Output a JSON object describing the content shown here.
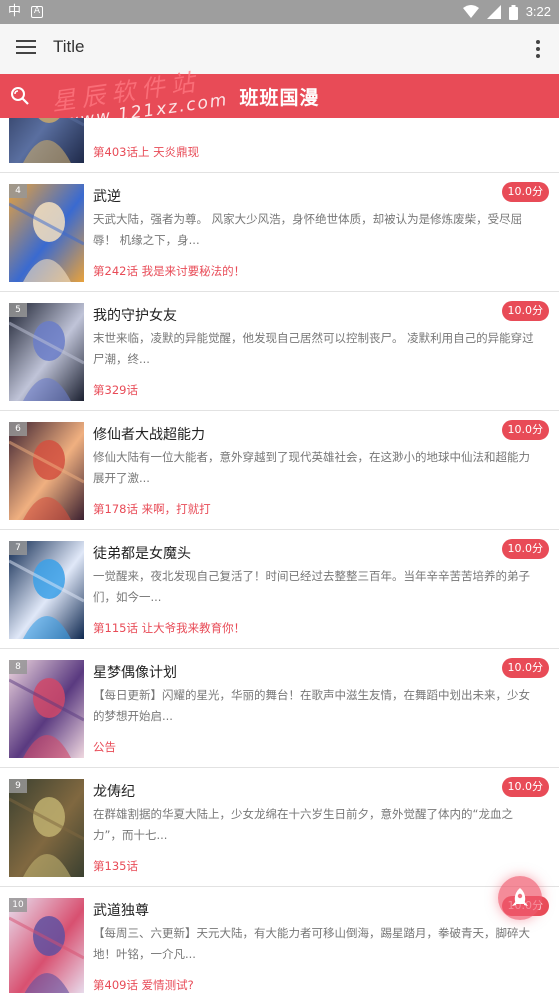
{
  "status_bar": {
    "time": "3:22"
  },
  "app_bar": {
    "title": "Title"
  },
  "header": {
    "brand": "班班国漫"
  },
  "watermark": {
    "cn": "星辰软件站",
    "url": "www.121xz.com"
  },
  "list": [
    {
      "rank": "",
      "title": "",
      "desc": "",
      "chapter": "第403话上 天炎鼎现",
      "score": "",
      "cover_colors": [
        "#1f2a4a",
        "#c8a86a",
        "#5a6fa0"
      ]
    },
    {
      "rank": "4",
      "title": "武逆",
      "desc": "天武大陆，强者为尊。 风家大少风浩，身怀绝世体质，却被认为是修炼废柴，受尽屈辱！ 机缘之下，身...",
      "chapter": "第242话 我是来讨要秘法的！",
      "score": "10.0分",
      "cover_colors": [
        "#e9a23b",
        "#f4e0c0",
        "#3a6ad0"
      ]
    },
    {
      "rank": "5",
      "title": "我的守护女友",
      "desc": "末世来临，凌默的异能觉醒，他发现自己居然可以控制丧尸。 凌默利用自己的异能穿过尸潮，终...",
      "chapter": "第329话",
      "score": "10.0分",
      "cover_colors": [
        "#1b2030",
        "#6a7cc8",
        "#c0c4d8"
      ]
    },
    {
      "rank": "6",
      "title": "修仙者大战超能力",
      "desc": "修仙大陆有一位大能者，意外穿越到了现代英雄社会，在这渺小的地球中仙法和超能力展开了激...",
      "chapter": "第178话 来啊，打就打",
      "score": "10.0分",
      "cover_colors": [
        "#3a2030",
        "#d25040",
        "#f0b080"
      ]
    },
    {
      "rank": "7",
      "title": "徒弟都是女魔头",
      "desc": "一觉醒来，夜北发现自己复活了！时间已经过去整整三百年。当年辛辛苦苦培养的弟子们，如今一...",
      "chapter": "第115话 让大爷我来教育你！",
      "score": "10.0分",
      "cover_colors": [
        "#0e2850",
        "#3aa0e8",
        "#e0e8f8"
      ]
    },
    {
      "rank": "8",
      "title": "星梦偶像计划",
      "desc": "【每日更新】闪耀的星光，华丽的舞台！在歌声中滋生友情，在舞蹈中划出未来，少女的梦想开始启...",
      "chapter": "公告",
      "score": "10.0分",
      "cover_colors": [
        "#f0d8e0",
        "#d04868",
        "#5a3a80"
      ]
    },
    {
      "rank": "9",
      "title": "龙俦纪",
      "desc": "在群雄割据的华夏大陆上，少女龙绵在十六岁生日前夕，意外觉醒了体内的“龙血之力”，而十七...",
      "chapter": "第135话",
      "score": "10.0分",
      "cover_colors": [
        "#3a4030",
        "#c0b070",
        "#806840"
      ]
    },
    {
      "rank": "10",
      "title": "武道独尊",
      "desc": "【每周三、六更新】天元大陆，有大能力者可移山倒海，踢星踏月，拳破青天，脚碎大地！叶铭，一介凡...",
      "chapter": "第409话 爱情测试?",
      "score": "10.0分",
      "cover_colors": [
        "#e8e0f0",
        "#6050a0",
        "#d85070"
      ]
    }
  ]
}
